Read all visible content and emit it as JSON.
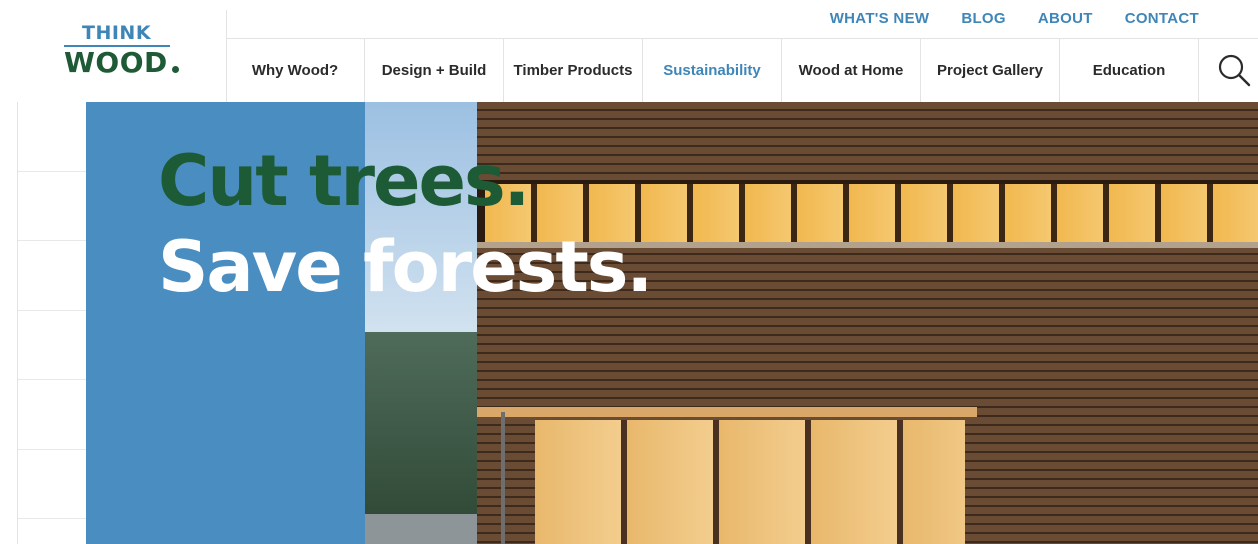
{
  "brand": {
    "think": "THINK",
    "wood": "WOOD"
  },
  "utility_nav": [
    "WHAT'S NEW",
    "BLOG",
    "ABOUT",
    "CONTACT"
  ],
  "main_nav": [
    {
      "label": "Why Wood?",
      "active": false
    },
    {
      "label": "Design + Build",
      "active": false
    },
    {
      "label": "Timber Products",
      "active": false
    },
    {
      "label": "Sustainability",
      "active": true
    },
    {
      "label": "Wood at Home",
      "active": false
    },
    {
      "label": "Project Gallery",
      "active": false
    },
    {
      "label": "Education",
      "active": false
    }
  ],
  "hero": {
    "line1": "Cut trees.",
    "line2": "Save forests."
  },
  "colors": {
    "brand_blue": "#3f86b8",
    "brand_green": "#1f5a36",
    "panel_blue": "#4a8dc0"
  },
  "icons": {
    "search": "search-icon"
  }
}
